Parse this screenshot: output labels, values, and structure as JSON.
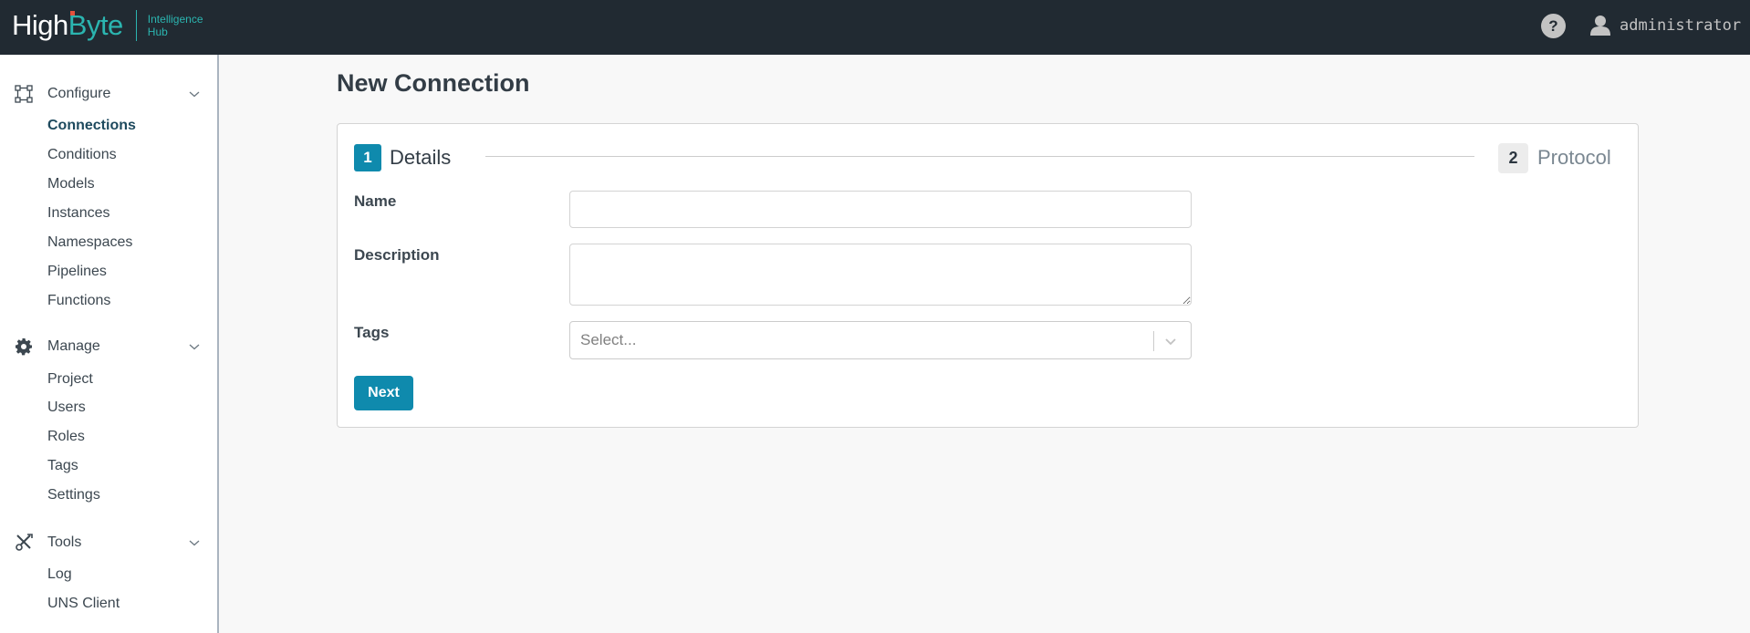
{
  "header": {
    "logo_high": "High",
    "logo_byte": "Byte",
    "logo_sub_line1": "Intelligence",
    "logo_sub_line2": "Hub",
    "help_label": "?",
    "user_name": "administrator"
  },
  "sidebar": {
    "groups": [
      {
        "label": "Configure",
        "icon": "nodes-icon",
        "items": [
          {
            "label": "Connections",
            "active": true
          },
          {
            "label": "Conditions"
          },
          {
            "label": "Models"
          },
          {
            "label": "Instances"
          },
          {
            "label": "Namespaces"
          },
          {
            "label": "Pipelines"
          },
          {
            "label": "Functions"
          }
        ]
      },
      {
        "label": "Manage",
        "icon": "gear-icon",
        "items": [
          {
            "label": "Project"
          },
          {
            "label": "Users"
          },
          {
            "label": "Roles"
          },
          {
            "label": "Tags"
          },
          {
            "label": "Settings"
          }
        ]
      },
      {
        "label": "Tools",
        "icon": "tools-icon",
        "items": [
          {
            "label": "Log"
          },
          {
            "label": "UNS Client"
          }
        ]
      }
    ]
  },
  "main": {
    "title": "New Connection",
    "steps": [
      {
        "number": "1",
        "label": "Details",
        "active": true
      },
      {
        "number": "2",
        "label": "Protocol",
        "active": false
      }
    ],
    "form": {
      "name_label": "Name",
      "name_value": "",
      "description_label": "Description",
      "description_value": "",
      "tags_label": "Tags",
      "tags_placeholder": "Select...",
      "next_label": "Next"
    }
  },
  "colors": {
    "topbar": "#212a32",
    "brand_teal": "#2bb5b0",
    "accent": "#0f8aad",
    "active_nav": "#1e4a5e"
  }
}
